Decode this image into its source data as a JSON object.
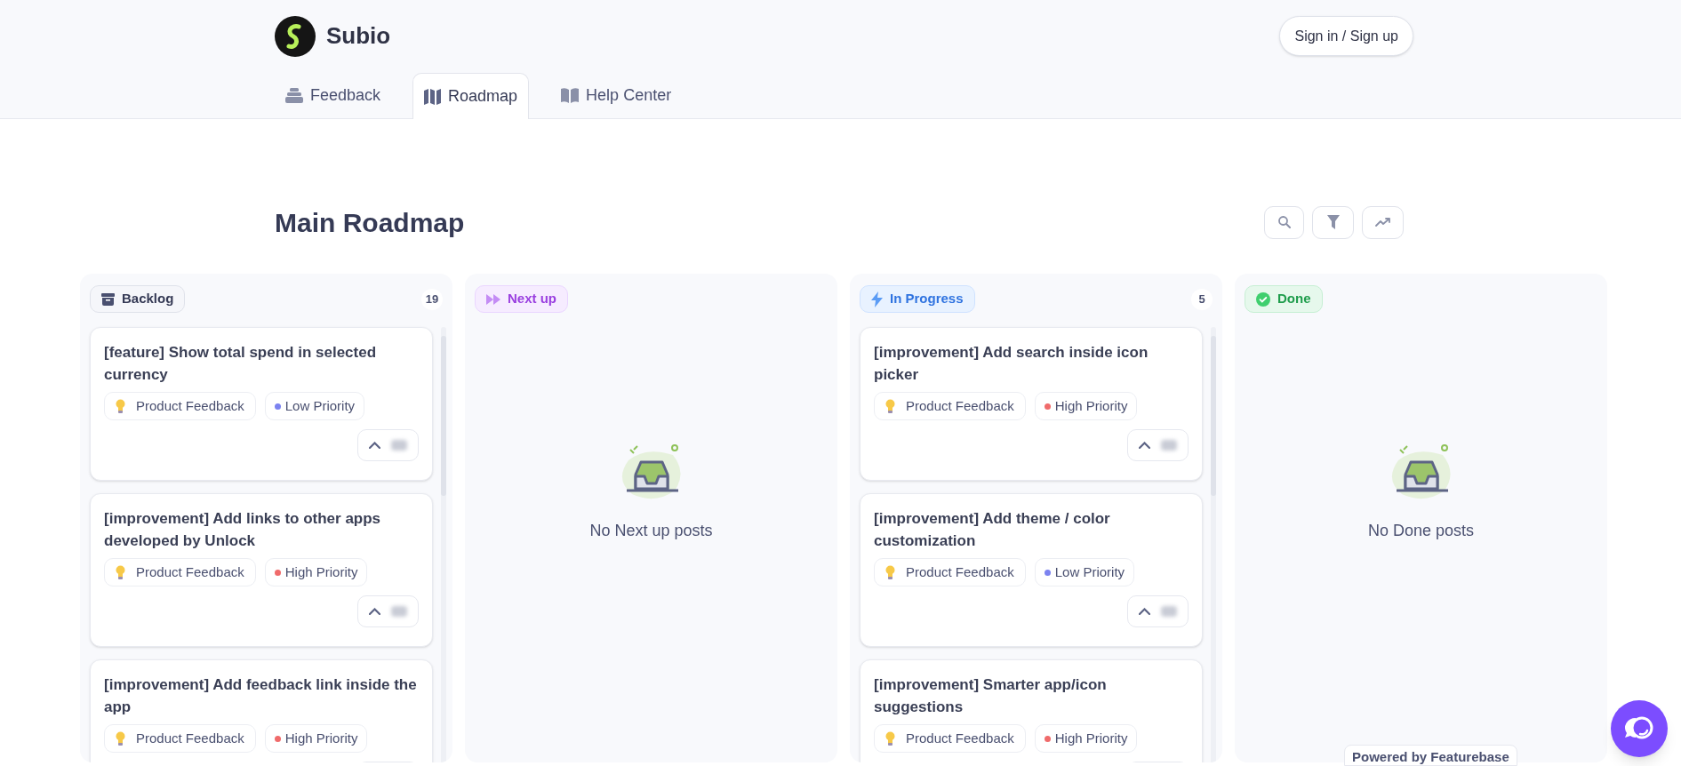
{
  "brand": {
    "name": "Subio"
  },
  "sign_in": "Sign in / Sign up",
  "nav_tabs": [
    {
      "label": "Feedback",
      "kind": "feedback",
      "selected": false
    },
    {
      "label": "Roadmap",
      "kind": "roadmap",
      "selected": true
    },
    {
      "label": "Help Center",
      "kind": "help",
      "selected": false
    }
  ],
  "title": "Main Roadmap",
  "columns": [
    {
      "label": "Backlog",
      "kind": "backlog",
      "count": "19",
      "posts": [
        {
          "title": "[feature] Show total spend in selected currency",
          "category": "Product Feedback",
          "priority": {
            "label": "Low Priority",
            "color": "#7c83f0"
          }
        },
        {
          "title": "[improvement] Add links to other apps developed by Unlock",
          "category": "Product Feedback",
          "priority": {
            "label": "High Priority",
            "color": "#f06b6b"
          }
        },
        {
          "title": "[improvement] Add feedback link inside the app",
          "category": "Product Feedback",
          "priority": {
            "label": "High Priority",
            "color": "#f06b6b"
          }
        }
      ]
    },
    {
      "label": "Next up",
      "kind": "next",
      "empty_text": "No Next up posts"
    },
    {
      "label": "In Progress",
      "kind": "progress",
      "count": "5",
      "posts": [
        {
          "title": "[improvement] Add search inside icon picker",
          "category": "Product Feedback",
          "priority": {
            "label": "High Priority",
            "color": "#f06b6b"
          }
        },
        {
          "title": "[improvement] Add theme / color customization",
          "category": "Product Feedback",
          "priority": {
            "label": "Low Priority",
            "color": "#7c83f0"
          }
        },
        {
          "title": "[improvement] Smarter app/icon suggestions",
          "category": "Product Feedback",
          "priority": {
            "label": "High Priority",
            "color": "#f06b6b"
          }
        }
      ]
    },
    {
      "label": "Done",
      "kind": "done",
      "empty_text": "No Done posts"
    }
  ],
  "powered_by": "Powered by Featurebase"
}
